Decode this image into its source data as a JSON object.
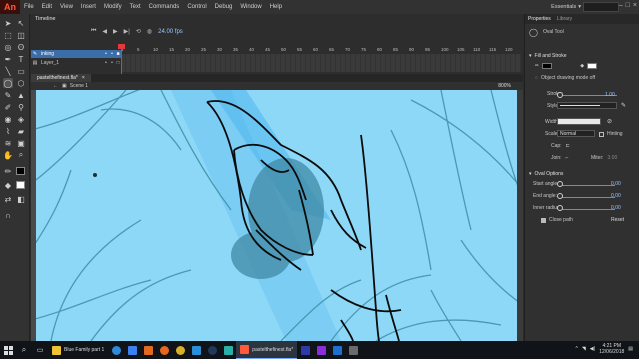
{
  "app": {
    "logo": "An",
    "accent": "#ff5a3c"
  },
  "menus": [
    "File",
    "Edit",
    "View",
    "Insert",
    "Modify",
    "Text",
    "Commands",
    "Control",
    "Debug",
    "Window",
    "Help"
  ],
  "workspace": {
    "label": "Essentials",
    "icon": "chevron-down-icon"
  },
  "timeline": {
    "tab": "Timeline",
    "fps": "24.00 fps",
    "frame_ticks": [
      "1",
      "5",
      "10",
      "15",
      "20",
      "25",
      "30",
      "35",
      "40",
      "45",
      "50",
      "55",
      "60",
      "65",
      "70",
      "75",
      "80",
      "85",
      "90",
      "95",
      "100",
      "105",
      "110",
      "115",
      "120"
    ],
    "layers": [
      {
        "name": "inking",
        "selected": true
      },
      {
        "name": "Layer_1",
        "selected": false
      }
    ]
  },
  "document": {
    "tab": "pastelthefinest.fla*",
    "scene": "Scene 1",
    "zoom": "800%"
  },
  "properties": {
    "tabs": [
      "Properties",
      "Library"
    ],
    "tool_name": "Oval Tool",
    "fill_stroke_label": "Fill and Stroke",
    "object_drawing_label": "Object drawing mode off",
    "stroke_label": "Stroke:",
    "stroke_value": "1.00",
    "style_label": "Style:",
    "width_label": "Width:",
    "scale_label": "Scale:",
    "scale_value": "Normal",
    "hinting_label": "Hinting",
    "cap_label": "Cap:",
    "join_label": "Join:",
    "miter_label": "Miter:",
    "miter_value": "3.00",
    "oval_options_label": "Oval Options",
    "start_angle_label": "Start angle:",
    "start_angle_value": "0.00",
    "end_angle_label": "End angle:",
    "end_angle_value": "0.00",
    "inner_radius_label": "Inner radius:",
    "inner_radius_value": "0.00",
    "close_path_label": "Close path",
    "reset_label": "Reset",
    "stroke_color": "#000000",
    "fill_color": "#ffffff"
  },
  "taskbar": {
    "items": [
      {
        "label": "Blue Family part 1",
        "icon": "folder-icon",
        "color": "#f1c232"
      },
      {
        "label": "pastelthefinest.fla*",
        "icon": "animate-icon",
        "color": "#ff5a3c"
      }
    ],
    "time": "4:21 PM",
    "date": "12/06/2018"
  }
}
